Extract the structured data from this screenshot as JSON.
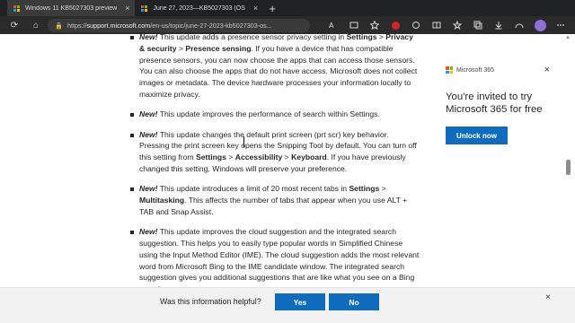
{
  "tabs": [
    {
      "title": "Windows 11 KB5027303 preview",
      "close": "×",
      "active": true
    },
    {
      "title": "June 27, 2023—KB5027303 (OS",
      "close": "×",
      "active": false
    }
  ],
  "new_tab": "+",
  "address": {
    "prefix": "https://",
    "host": "support.microsoft.com",
    "path": "/en-us/topic/june-27-2023-kb5027303-os..."
  },
  "icons": {
    "back": "←",
    "refresh": "⟳",
    "home": "⌂",
    "info": "🔒"
  },
  "content": {
    "items": [
      {
        "new": "New!",
        "parts": [
          " This update adds a presence sensor privacy setting in ",
          "Settings",
          " > ",
          "Privacy & security",
          " > ",
          "Presence sensing",
          ". If you have a device that has compatible presence sensors, you can now choose the apps that can access those sensors. You can also choose the apps that do not have access. Microsoft does not collect images or metadata. The device hardware processes your information locally to maximize privacy."
        ]
      },
      {
        "new": "New!",
        "text": " This update improves the performance of search within Settings."
      },
      {
        "new": "New!",
        "parts": [
          " This update changes the default print screen (prt scr) key behavior. Pressing the print screen key opens the Snipping Tool by default. You can turn off this setting from ",
          "Settings",
          " > ",
          "Accessibility",
          " > ",
          "Keyboard",
          ". If you have previously changed this setting, Windows will preserve your preference."
        ]
      },
      {
        "new": "New!",
        "parts": [
          " This update introduces a limit of 20 most recent tabs in ",
          "Settings",
          " > ",
          "Multitasking",
          ". This affects the number of tabs that appear when you use ALT + TAB and Snap Assist."
        ]
      },
      {
        "new": "New!",
        "text": " This update improves the cloud suggestion and the integrated search suggestion. This helps you to easily type popular words in Simplified Chinese using the Input Method Editor (IME). The cloud suggestion adds the most relevant word from Microsoft Bing to the IME candidate window. The integrated search suggestion gives you additional suggestions that are like what you see on a Bing search page."
      }
    ]
  },
  "promo": {
    "brand": "Microsoft 365",
    "close": "×",
    "text": "You're invited to try Microsoft 365 for free",
    "button": "Unlock now"
  },
  "feedback": {
    "question": "Was this information helpful?",
    "yes": "Yes",
    "no": "No",
    "close": "×"
  }
}
